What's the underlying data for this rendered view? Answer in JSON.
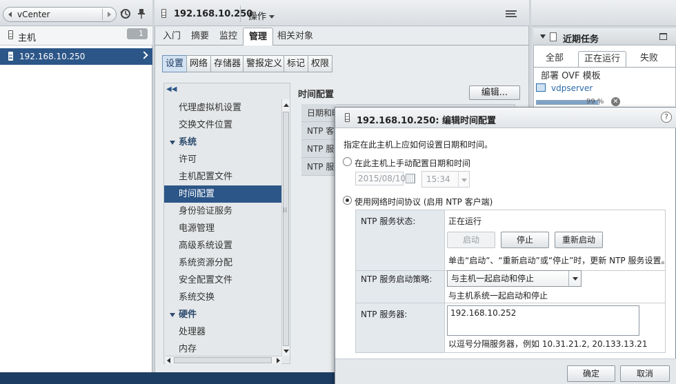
{
  "navigator": {
    "back_label": "vCenter",
    "hosts_label": "主机",
    "hosts_count": "1",
    "selected_host": "192.168.10.250"
  },
  "main": {
    "host_title": "192.168.10.250",
    "actions_label": "操作",
    "tabs": [
      "入门",
      "摘要",
      "监控",
      "管理",
      "相关对象"
    ],
    "active_tab": "管理",
    "subtabs": [
      "设置",
      "网络",
      "存储器",
      "警报定义",
      "标记",
      "权限"
    ],
    "active_subtab": "设置",
    "settings_items": [
      {
        "label": "代理虚拟机设置",
        "type": "item"
      },
      {
        "label": "交换文件位置",
        "type": "item"
      },
      {
        "label": "系统",
        "type": "group"
      },
      {
        "label": "许可",
        "type": "item"
      },
      {
        "label": "主机配置文件",
        "type": "item"
      },
      {
        "label": "时间配置",
        "type": "item",
        "selected": true
      },
      {
        "label": "身份验证服务",
        "type": "item"
      },
      {
        "label": "电源管理",
        "type": "item"
      },
      {
        "label": "高级系统设置",
        "type": "item"
      },
      {
        "label": "系统资源分配",
        "type": "item"
      },
      {
        "label": "安全配置文件",
        "type": "item"
      },
      {
        "label": "系统交换",
        "type": "item"
      },
      {
        "label": "硬件",
        "type": "group"
      },
      {
        "label": "处理器",
        "type": "item"
      },
      {
        "label": "内存",
        "type": "item"
      }
    ],
    "content_title": "时间配置",
    "edit_button": "编辑...",
    "content_rows": [
      "日期和时",
      "NTP 客户",
      "NTP 服务",
      "NTP 服务"
    ]
  },
  "tasks": {
    "title": "近期任务",
    "tabs": [
      "全部",
      "正在运行",
      "失败"
    ],
    "active_tab": "正在运行",
    "task_name": "部署 OVF 模板",
    "task_target": "vdpserver",
    "progress_text": "99 %",
    "progress_value": 0.99
  },
  "dialog": {
    "title": "192.168.10.250: 编辑时间配置",
    "help": "?",
    "instruction": "指定在此主机上应如何设置日期和时间。",
    "option_manual": "在此主机上手动配置日期和时间",
    "date_value": "2015/08/10",
    "time_value": "15:34",
    "option_ntp": "使用网络时间协议 (启用 NTP 客户端)",
    "selected_option": "ntp",
    "ntp_status_label": "NTP 服务状态:",
    "ntp_status_value": "正在运行",
    "start_button": "启动",
    "stop_button": "停止",
    "restart_button": "重新启动",
    "ntp_status_hint": "单击“启动”、“重新启动”或“停止”时，更新 NTP 服务设置。",
    "policy_label": "NTP 服务启动策略:",
    "policy_value": "与主机一起启动和停止",
    "policy_hint": "与主机系统一起启动和停止",
    "servers_label": "NTP 服务器:",
    "servers_value": "192.168.10.252",
    "servers_hint": "以逗号分隔服务器，例如 10.31.21.2, 20.133.13.21",
    "ok_button": "确定",
    "cancel_button": "取消"
  }
}
